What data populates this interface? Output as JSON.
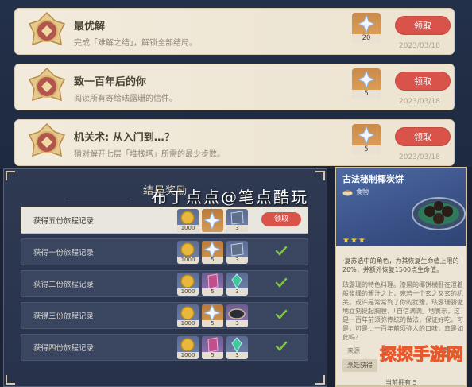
{
  "achievements": [
    {
      "title": "最优解",
      "desc": "完成「难解之结」，解锁全部结局。",
      "reward_count": "20",
      "claim_label": "领取",
      "date": "2023/03/18"
    },
    {
      "title": "致一百年后的你",
      "desc": "阅读所有寄给珐露珊的信件。",
      "reward_count": "5",
      "claim_label": "领取",
      "date": "2023/03/18"
    },
    {
      "title": "机关术: 从入门到…？",
      "desc": "猜对解开七层「堆栈塔」所需的最少步数。",
      "reward_count": "5",
      "claim_label": "领取",
      "date": "2023/03/18"
    }
  ],
  "reward_panel": {
    "title": "结局奖励",
    "rows": [
      {
        "label": "获得五份旅程记录",
        "items": [
          {
            "count": "1000"
          },
          {
            "count": ""
          },
          {
            "count": "3"
          }
        ],
        "claim_label": "领取",
        "claimed": false
      },
      {
        "label": "获得一份旅程记录",
        "items": [
          {
            "count": "1000"
          },
          {
            "count": "5"
          },
          {
            "count": "3"
          }
        ],
        "claimed": true
      },
      {
        "label": "获得二份旅程记录",
        "items": [
          {
            "count": "1000"
          },
          {
            "count": "5"
          },
          {
            "count": "3"
          }
        ],
        "claimed": true
      },
      {
        "label": "获得三份旅程记录",
        "items": [
          {
            "count": "1000"
          },
          {
            "count": "5"
          },
          {
            "count": "3"
          }
        ],
        "claimed": true
      },
      {
        "label": "获得四份旅程记录",
        "items": [
          {
            "count": "1000"
          },
          {
            "count": "5"
          },
          {
            "count": "3"
          }
        ],
        "claimed": true
      }
    ]
  },
  "food_card": {
    "name": "古法秘制椰炭饼",
    "type": "食物",
    "stars": "★★★",
    "effect": "·复苏选中的角色，为其恢复生命值上限的20%，并额外恢复1500点生命值。",
    "desc": "珐露珊的特色料理。漆黑的椰饼横卧在澄着般浆绿的酱汁之上，宛若一个玄之又玄的机关。或许是常常到了你的犹豫，珐露珊骄傲地立刻挺起胸膛，「自信满满」地表示，这是一百年前须弥传统的做法，保证好吃。可是，可是…一百年前须弥人的口味，真是如此吗？",
    "source_label": "来源",
    "source_button": "烹饪获得",
    "owned": "当前拥有 5"
  },
  "watermarks": {
    "center": "布丁点点@笔点酷玩",
    "corner": "探探手游网"
  },
  "colors": {
    "claim_red": "#d9534a",
    "check_green": "#7dc63e",
    "panel_bg": "#2f3a52",
    "card_bg": "#ece5d6",
    "star_gold": "#f4c842"
  }
}
